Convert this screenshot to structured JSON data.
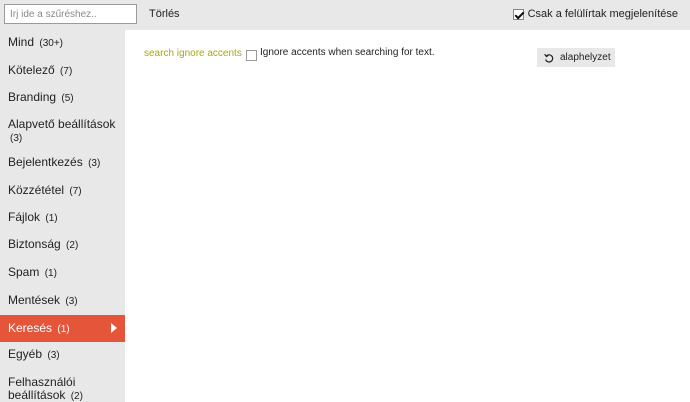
{
  "toolbar": {
    "filter_placeholder": "Írj ide a szűréshez..",
    "filter_value": "",
    "clear_label": "Törlés",
    "show_overridden_label": "Csak a felülírtak megjelenítése",
    "show_overridden_checked": true
  },
  "sidebar": {
    "items": [
      {
        "label": "Mind",
        "count": "(30+)"
      },
      {
        "label": "Kötelező",
        "count": "(7)"
      },
      {
        "label": "Branding",
        "count": "(5)"
      },
      {
        "label": "Alapvető beállítások",
        "count": "(3)"
      },
      {
        "label": "Bejelentkezés",
        "count": "(3)"
      },
      {
        "label": "Közzététel",
        "count": "(7)"
      },
      {
        "label": "Fájlok",
        "count": "(1)"
      },
      {
        "label": "Biztonság",
        "count": "(2)"
      },
      {
        "label": "Spam",
        "count": "(1)"
      },
      {
        "label": "Mentések",
        "count": "(3)"
      },
      {
        "label": "Keresés",
        "count": "(1)"
      },
      {
        "label": "Egyéb",
        "count": "(3)"
      },
      {
        "label": "Felhasználói beállítások",
        "count": "(2)"
      }
    ],
    "active_item": "Keresés"
  },
  "main": {
    "setting": {
      "name": "search ignore accents",
      "checked": false,
      "description": "Ignore accents when searching for text.",
      "reset_label": "alaphelyzet"
    }
  },
  "colors": {
    "accent": "#e5553a",
    "setting_name": "#a8a812",
    "panel_bg": "#e8e8e8"
  },
  "icons": {
    "active_arrow": "arrow-right-icon",
    "reset": "undo-icon",
    "checkbox": "checkmark-icon"
  }
}
